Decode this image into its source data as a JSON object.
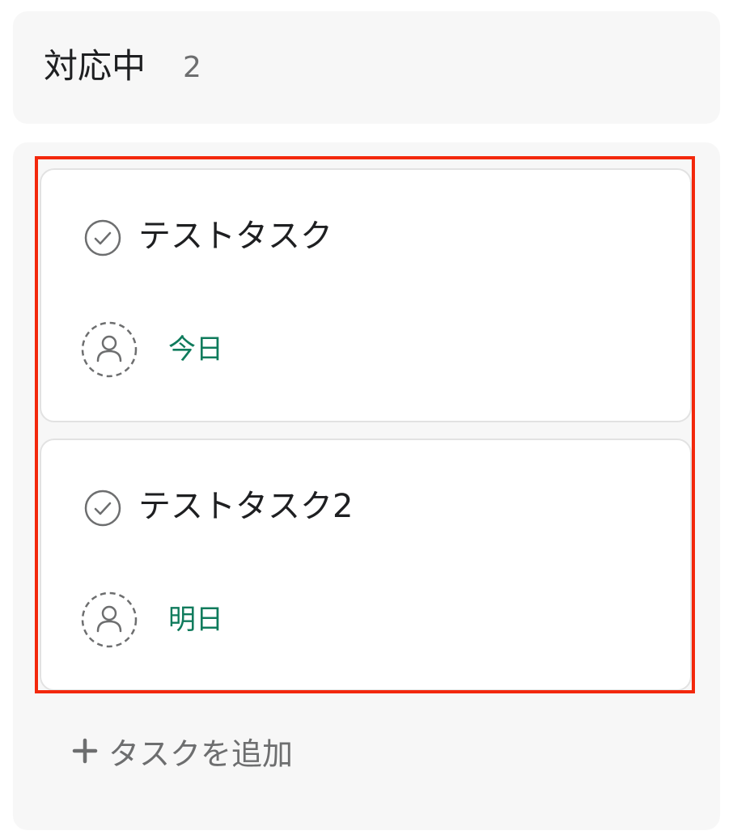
{
  "column": {
    "title": "対応中",
    "count": "2"
  },
  "tasks": [
    {
      "title": "テストタスク",
      "due": "今日",
      "due_color": "#0f7b5c",
      "icon": "check-circle-icon",
      "assignee_icon": "unassigned-user-icon"
    },
    {
      "title": "テストタスク2",
      "due": "明日",
      "due_color": "#0f7b5c",
      "icon": "check-circle-icon",
      "assignee_icon": "unassigned-user-icon"
    }
  ],
  "add_task": {
    "label": "タスクを追加",
    "icon": "plus-icon"
  },
  "colors": {
    "highlight": "#f3280c",
    "panel_bg": "#f7f7f7",
    "text_primary": "#1e1f21",
    "text_secondary": "#6d6e6f"
  }
}
